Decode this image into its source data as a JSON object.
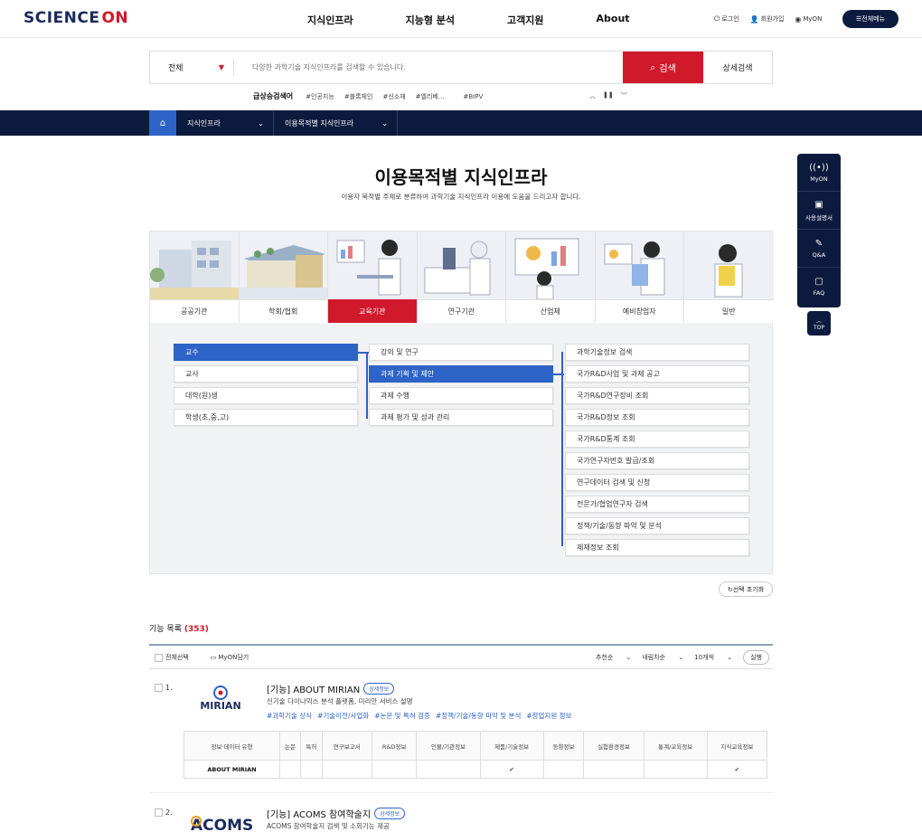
{
  "header": {
    "logo_main": "SCIENCE",
    "logo_on": "ON",
    "nav": [
      "지식인프라",
      "지능형 분석",
      "고객지원",
      "About"
    ],
    "util": {
      "login": "로그인",
      "join": "회원가입",
      "myon": "MyON"
    },
    "all_menu": "전체메뉴"
  },
  "search": {
    "category": "전체",
    "placeholder": "다양한 과학기술 지식인프라를 검색할 수 있습니다.",
    "button": "검색",
    "advanced": "상세검색"
  },
  "trending": {
    "label": "급상승검색어",
    "tags": [
      "#인공지능",
      "#블록체인",
      "#신소재",
      "#엘리베...",
      "#BIPV"
    ]
  },
  "breadcrumb": {
    "level1": "지식인프라",
    "level2": "이용목적별 지식인프라"
  },
  "page": {
    "title": "이용목적별 지식인프라",
    "subtitle": "이용자 목적별 주제로 분류하여 과학기술 지식인프라 이용에 도움을 드리고자 합니다."
  },
  "categories": [
    "공공기관",
    "학회/협회",
    "교육기관",
    "연구기관",
    "산업체",
    "예비창업자",
    "일반"
  ],
  "active_category": "교육기관",
  "column1": [
    "교수",
    "교사",
    "대학(원)생",
    "학생(초,중,고)"
  ],
  "column2": [
    "강의 및 연구",
    "과제 기획 및 제안",
    "과제 수행",
    "과제 평가 및 성과 관리"
  ],
  "column3": [
    "과학기술정보 검색",
    "국가R&D사업 및 과제 공고",
    "국가R&D연구장비 조회",
    "국가R&D정보 조회",
    "국가R&D통계 조회",
    "국가연구자번호 발급/조회",
    "연구데이터 검색 및 신청",
    "전문가/협업연구자 검색",
    "정책/기술/동향 파악 및 분석",
    "제재정보 조회"
  ],
  "reset_label": "선택 초기화",
  "list": {
    "title": "기능 목록",
    "count": "(353)",
    "select_all": "전체선택",
    "myon_add": "MyON담기",
    "sort": "추천순",
    "order": "내림차순",
    "per_page": "10개씩",
    "apply": "실행"
  },
  "items": [
    {
      "num": "1.",
      "logo": "MIRIAN",
      "title": "[기능] ABOUT MIRIAN",
      "badge": "상세정보",
      "desc": "신기술 다이나믹스 분석 플랫폼, 미리안 서비스 설명",
      "tags": [
        "#과학기술 상식",
        "#기술이전/사업화",
        "#논문 및 특허 검증",
        "#정책/기술/동향 파악 및 분석",
        "#창업지원 정보"
      ]
    },
    {
      "num": "2.",
      "logo": "ACOMS",
      "title": "[기능] ACOMS 참여학술지",
      "badge": "상세정보",
      "desc": "ACOMS 참여학술지 검색 및 소회기능 제공"
    }
  ],
  "info_table": {
    "headers": [
      "정보·데이터 유형",
      "논문",
      "특허",
      "연구보고서",
      "R&D정보",
      "인물/기관정보",
      "제품/기술정보",
      "동향정보",
      "실험환경정보",
      "통계/교육정보",
      "지식교육정보"
    ],
    "row_name": "ABOUT MIRIAN",
    "check_mark": "✔"
  },
  "quick_menu": [
    "MyON",
    "사용설명서",
    "Q&A",
    "FAQ"
  ],
  "top_label": "TOP",
  "colors": {
    "brand_red": "#d0192b",
    "navy": "#0c1a3d",
    "blue": "#2e63c7"
  }
}
